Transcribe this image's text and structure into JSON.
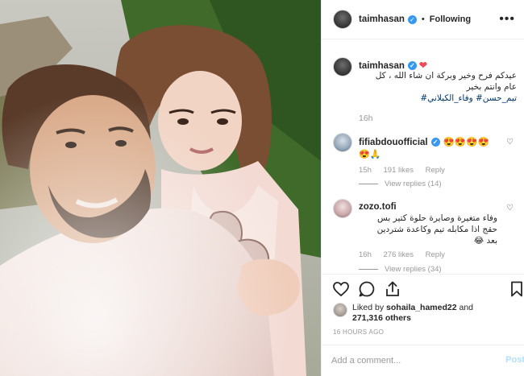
{
  "post": {
    "author": "taimhasan",
    "follow_label": "Following",
    "more_label": "•••",
    "caption": {
      "username": "taimhasan",
      "heart": "❤",
      "text_line1": "عيدكم فرح وخير وبركة ان شاء الله ، كل",
      "text_line2": "عام وانتم بخير",
      "hashtags": "تيم_حسن# وفاء_الكيلاني#",
      "time": "16h"
    },
    "comments": [
      {
        "username": "fifiabdouofficial",
        "emojis_line1": "😍😍😍😍",
        "emojis_line2": "😍🙏",
        "time": "15h",
        "likes": "191 likes",
        "reply": "Reply",
        "view_replies": "View replies (14)"
      },
      {
        "username": "zozo.tofi",
        "text_line1": "وفاء متغيرة وصايرة حلوة كتير بس",
        "text_line2": "حقج اذا مكابله تيم وكاعدة شتردين",
        "text_line3": "بعد 😂",
        "time": "16h",
        "likes": "276 likes",
        "reply": "Reply",
        "view_replies": "View replies (34)"
      }
    ],
    "liked_by": {
      "prefix": "Liked by",
      "user": "sohaila_hamed22",
      "and": "and",
      "others": "271,316 others"
    },
    "timestamp": "16 HOURS AGO",
    "comment_input": {
      "placeholder": "Add a comment...",
      "post_label": "Post"
    }
  },
  "icons": [
    "heart-outline-icon",
    "comment-icon",
    "share-icon",
    "bookmark-icon",
    "verified-icon",
    "more-icon"
  ],
  "colors": {
    "link": "#003569",
    "verified": "#3897f0",
    "muted": "#999999",
    "post_button": "#b2dffc",
    "heart": "#ed4956"
  }
}
